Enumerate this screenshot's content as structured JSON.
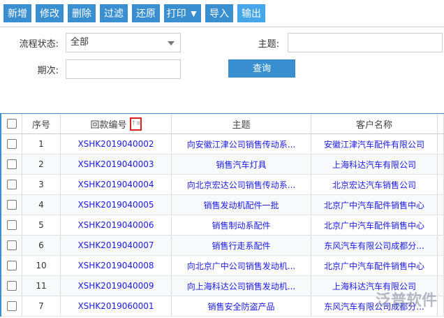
{
  "toolbar": {
    "add": "新增",
    "edit": "修改",
    "delete": "删除",
    "filter": "过滤",
    "restore": "还原",
    "print": "打印 ▼",
    "import": "导入",
    "export": "输出"
  },
  "filters": {
    "status_label": "流程状态:",
    "status_value": "全部",
    "subject_label": "主题:",
    "subject_value": "",
    "period_label": "期次:",
    "period_value": "",
    "query": "查询"
  },
  "table": {
    "headers": [
      "序号",
      "回款编号",
      "主题",
      "客户名称"
    ],
    "sort_icon": "↑≡",
    "rows": [
      {
        "no": "1",
        "code": "XSHK2019040002",
        "subject": "向安徽江津公司销售传动系...",
        "customer": "安徽江津汽车配件有限公司"
      },
      {
        "no": "2",
        "code": "XSHK2019040003",
        "subject": "销售汽车灯具",
        "customer": "上海科达汽车有限公司"
      },
      {
        "no": "3",
        "code": "XSHK2019040004",
        "subject": "向北京宏达公司销售传动系...",
        "customer": "北京宏达汽车销售公司"
      },
      {
        "no": "4",
        "code": "XSHK2019040005",
        "subject": "销售发动机配件一批",
        "customer": "北京广中汽车配件销售中心"
      },
      {
        "no": "5",
        "code": "XSHK2019040006",
        "subject": "销售制动系配件",
        "customer": "北京广中汽车配件销售中心"
      },
      {
        "no": "6",
        "code": "XSHK2019040007",
        "subject": "销售行走系配件",
        "customer": "东风汽车有限公司成都分..."
      },
      {
        "no": "10",
        "code": "XSHK2019040008",
        "subject": "向北京广中公司销售发动机...",
        "customer": "北京广中汽车配件销售中心"
      },
      {
        "no": "11",
        "code": "XSHK2019040009",
        "subject": "向上海科达公司销售发动机...",
        "customer": "上海科达汽车有限公司"
      },
      {
        "no": "7",
        "code": "XSHK2019060001",
        "subject": "销售安全防盗产品",
        "customer": "东风汽车有限公司成都分..."
      }
    ]
  },
  "watermark": "泛普软件"
}
